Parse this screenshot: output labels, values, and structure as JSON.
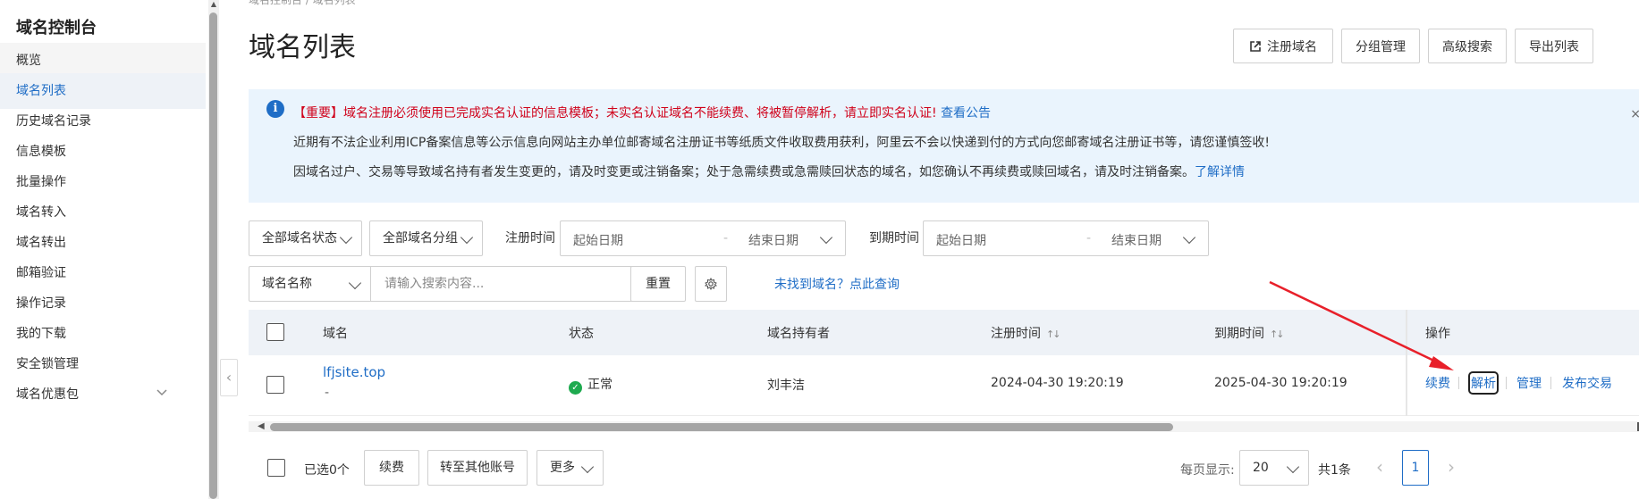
{
  "sidebar": {
    "title": "域名控制台",
    "items": [
      {
        "label": "概览"
      },
      {
        "label": "域名列表"
      },
      {
        "label": "历史域名记录"
      },
      {
        "label": "信息模板"
      },
      {
        "label": "批量操作"
      },
      {
        "label": "域名转入"
      },
      {
        "label": "域名转出"
      },
      {
        "label": "邮箱验证"
      },
      {
        "label": "操作记录"
      },
      {
        "label": "我的下载"
      },
      {
        "label": "安全锁管理"
      },
      {
        "label": "域名优惠包"
      }
    ],
    "active_index": 1
  },
  "header": {
    "breadcrumb": "域名控制台  /  域名列表",
    "title": "域名列表",
    "buttons": {
      "register": "注册域名",
      "group": "分组管理",
      "advanced": "高级搜索",
      "export": "导出列表"
    }
  },
  "notice": {
    "line1": "【重要】域名注册必须使用已完成实名认证的信息模板；未实名认证域名不能续费、将被暂停解析，请立即实名认证!",
    "line1_link": "查看公告",
    "line2": "近期有不法企业利用ICP备案信息等公示信息向网站主办单位邮寄域名注册证书等纸质文件收取费用获利，阿里云不会以快递到付的方式向您邮寄域名注册证书等，请您谨慎签收!",
    "line3": "因域名过户、交易等导致域名持有者发生变更的，请及时变更或注销备案；处于急需续费或急需赎回状态的域名，如您确认不再续费或赎回域名，请及时注销备案。",
    "line3_link": "了解详情",
    "close": "×"
  },
  "filters": {
    "status_select": "全部域名状态",
    "group_select": "全部域名分组",
    "reg_time_label": "注册时间",
    "exp_time_label": "到期时间",
    "start_placeholder": "起始日期",
    "end_placeholder": "结束日期",
    "separator": "-",
    "search_field_select": "域名名称",
    "search_placeholder": "请输入搜索内容...",
    "reset": "重置",
    "not_found_link": "未找到域名？点此查询"
  },
  "table": {
    "columns": {
      "domain": "域名",
      "status": "状态",
      "owner": "域名持有者",
      "reg_time": "注册时间",
      "exp_time": "到期时间",
      "ops": "操作"
    },
    "sort_glyph": "↑↓",
    "rows": [
      {
        "domain": "lfjsite.top",
        "sub": "-",
        "status": "正常",
        "owner": "刘丰洁",
        "reg_time": "2024-04-30 19:20:19",
        "exp_time": "2025-04-30 19:20:19",
        "ops": [
          "续费",
          "解析",
          "管理",
          "发布交易"
        ]
      }
    ]
  },
  "footer": {
    "selected": "已选0个",
    "renew": "续费",
    "transfer": "转至其他账号",
    "more": "更多",
    "page_size_label": "每页显示:",
    "page_size": "20",
    "total": "共1条",
    "current_page": "1"
  },
  "colors": {
    "accent": "#1f6dc6",
    "notice_bg": "#eaf4fd",
    "important_text": "#d0021b",
    "status_ok": "#1eaa4f",
    "annotation_arrow": "#e8202a"
  }
}
